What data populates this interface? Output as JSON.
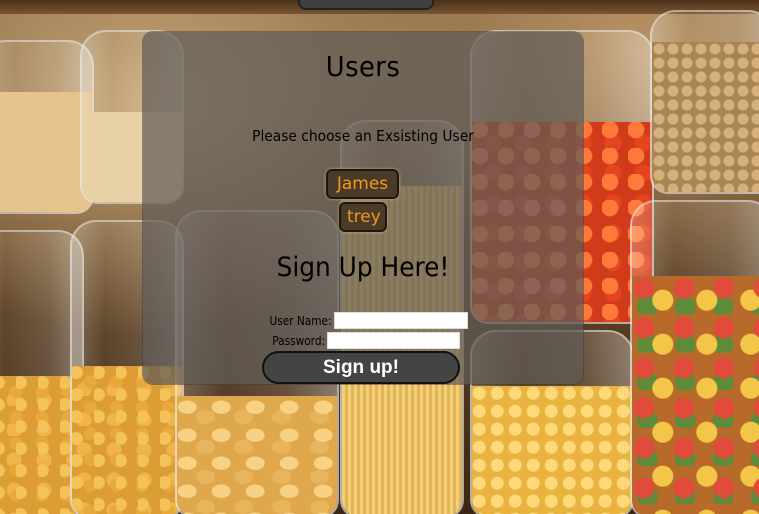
{
  "users_section": {
    "title": "Users",
    "prompt": "Please choose an Exsisting User",
    "users": [
      {
        "name": "James"
      },
      {
        "name": "trey"
      }
    ]
  },
  "signup_section": {
    "title": "Sign Up Here!",
    "username_label": "User Name:",
    "username_value": "",
    "password_label": "Password:",
    "password_value": "",
    "submit_label": "Sign up!"
  },
  "colors": {
    "panel_bg": "#5f5c58",
    "user_button_text": "#f09a1a",
    "user_button_bg": "#4a3a28",
    "signup_button_bg": "#444444"
  },
  "icons": {
    "background": "pantry-jars-background"
  }
}
